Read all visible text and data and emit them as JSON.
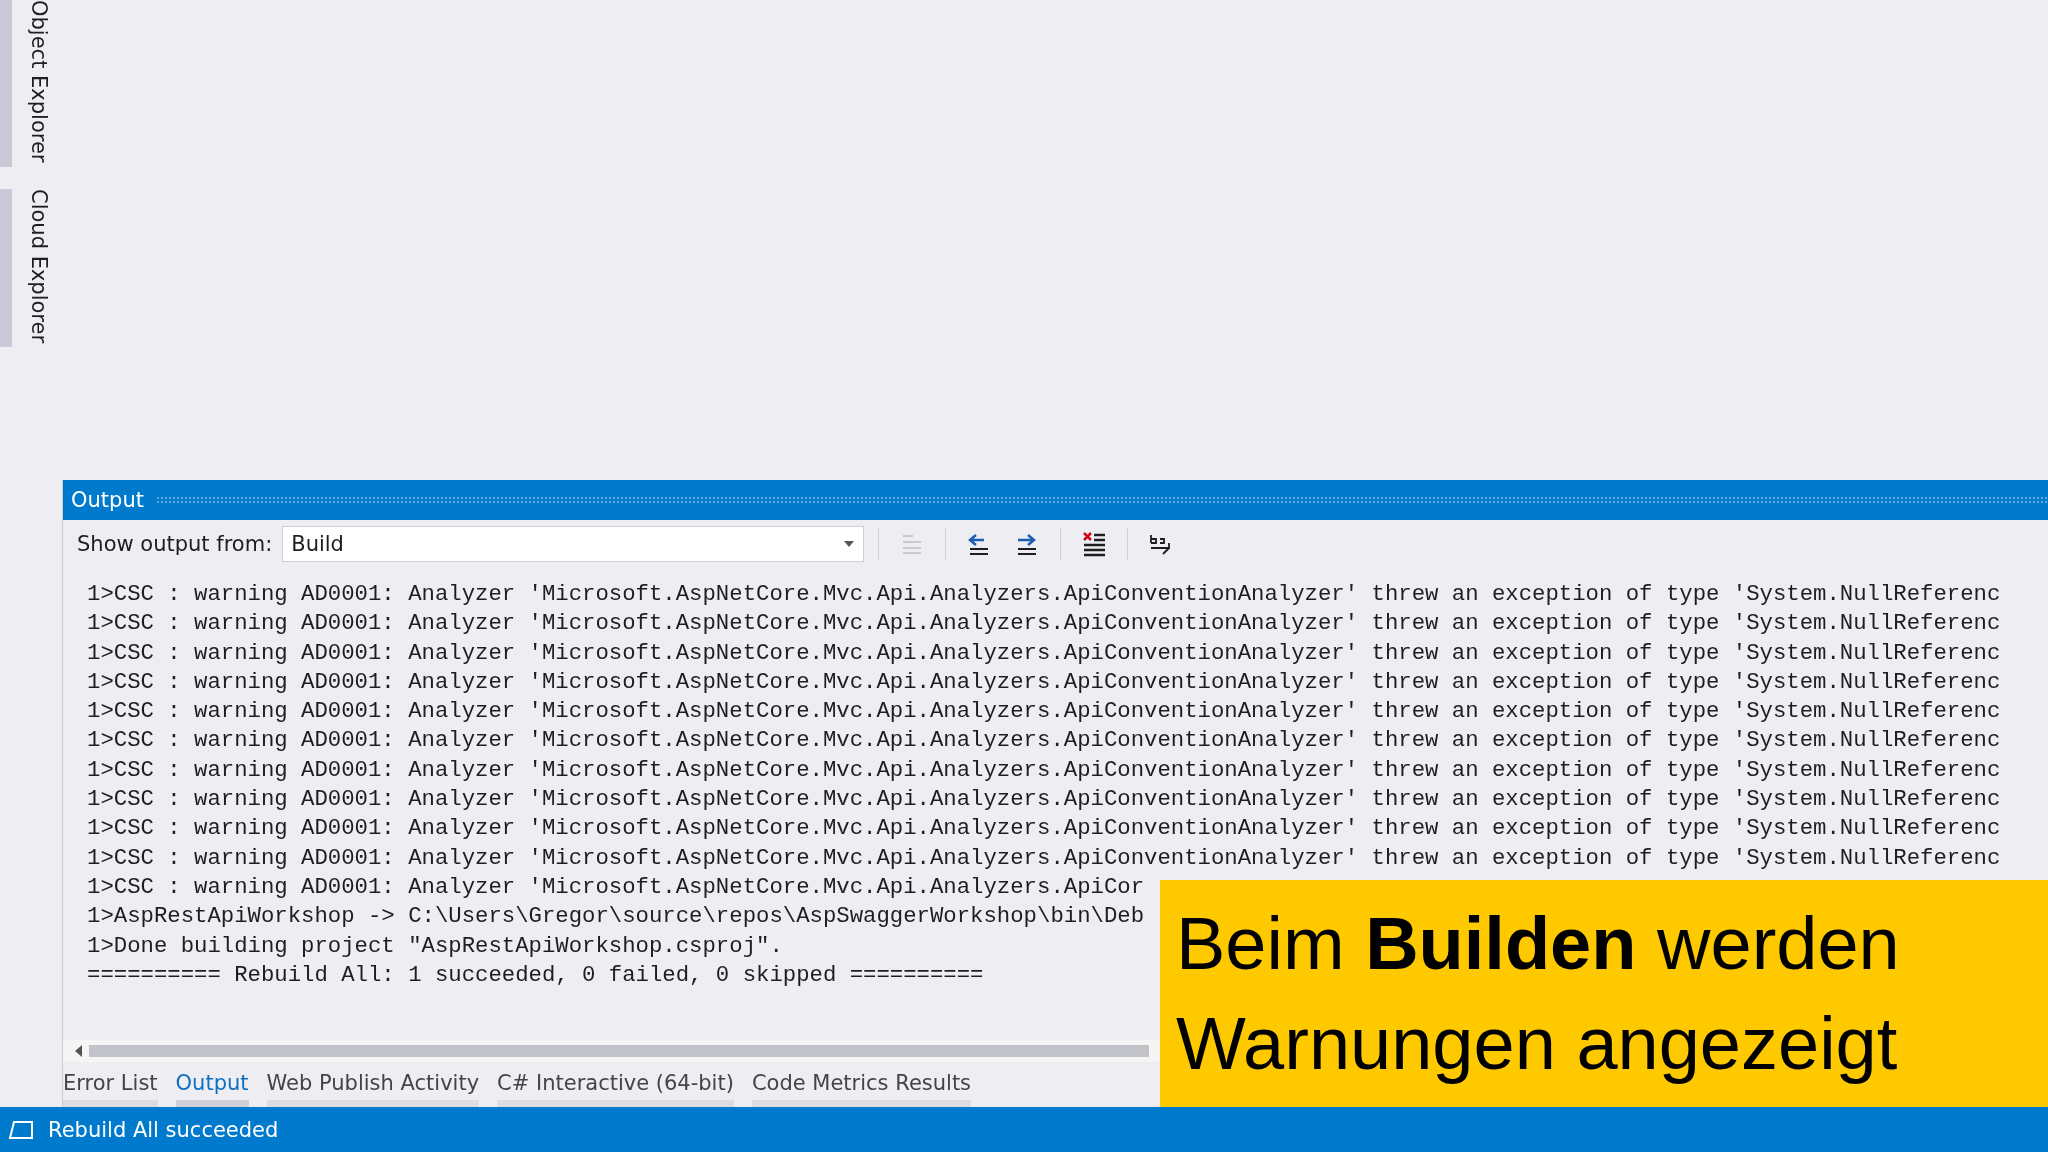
{
  "side_tabs": [
    {
      "label": "Object Explorer"
    },
    {
      "label": "Cloud Explorer"
    }
  ],
  "output_panel": {
    "title": "Output",
    "show_output_from": {
      "label": "Show output from:",
      "value": "Build"
    },
    "toolbar": [
      {
        "kind": "find-message",
        "disabled": true
      },
      {
        "kind": "previous-message",
        "disabled": false
      },
      {
        "kind": "next-message",
        "disabled": false
      },
      {
        "kind": "clear-all",
        "disabled": false
      },
      {
        "kind": "word-wrap",
        "disabled": false
      }
    ],
    "lines": [
      "1>CSC : warning AD0001: Analyzer 'Microsoft.AspNetCore.Mvc.Api.Analyzers.ApiConventionAnalyzer' threw an exception of type 'System.NullReferenc",
      "1>CSC : warning AD0001: Analyzer 'Microsoft.AspNetCore.Mvc.Api.Analyzers.ApiConventionAnalyzer' threw an exception of type 'System.NullReferenc",
      "1>CSC : warning AD0001: Analyzer 'Microsoft.AspNetCore.Mvc.Api.Analyzers.ApiConventionAnalyzer' threw an exception of type 'System.NullReferenc",
      "1>CSC : warning AD0001: Analyzer 'Microsoft.AspNetCore.Mvc.Api.Analyzers.ApiConventionAnalyzer' threw an exception of type 'System.NullReferenc",
      "1>CSC : warning AD0001: Analyzer 'Microsoft.AspNetCore.Mvc.Api.Analyzers.ApiConventionAnalyzer' threw an exception of type 'System.NullReferenc",
      "1>CSC : warning AD0001: Analyzer 'Microsoft.AspNetCore.Mvc.Api.Analyzers.ApiConventionAnalyzer' threw an exception of type 'System.NullReferenc",
      "1>CSC : warning AD0001: Analyzer 'Microsoft.AspNetCore.Mvc.Api.Analyzers.ApiConventionAnalyzer' threw an exception of type 'System.NullReferenc",
      "1>CSC : warning AD0001: Analyzer 'Microsoft.AspNetCore.Mvc.Api.Analyzers.ApiConventionAnalyzer' threw an exception of type 'System.NullReferenc",
      "1>CSC : warning AD0001: Analyzer 'Microsoft.AspNetCore.Mvc.Api.Analyzers.ApiConventionAnalyzer' threw an exception of type 'System.NullReferenc",
      "1>CSC : warning AD0001: Analyzer 'Microsoft.AspNetCore.Mvc.Api.Analyzers.ApiConventionAnalyzer' threw an exception of type 'System.NullReferenc",
      "1>CSC : warning AD0001: Analyzer 'Microsoft.AspNetCore.Mvc.Api.Analyzers.ApiCor",
      "1>AspRestApiWorkshop -> C:\\Users\\Gregor\\source\\repos\\AspSwaggerWorkshop\\bin\\Deb",
      "1>Done building project \"AspRestApiWorkshop.csproj\".",
      "========== Rebuild All: 1 succeeded, 0 failed, 0 skipped =========="
    ],
    "tabs": [
      {
        "label": "Error List",
        "selected": false
      },
      {
        "label": "Output",
        "selected": true
      },
      {
        "label": "Web Publish Activity",
        "selected": false
      },
      {
        "label": "C# Interactive (64-bit)",
        "selected": false
      },
      {
        "label": "Code Metrics Results",
        "selected": false
      }
    ]
  },
  "caption": [
    "Beim **Builden** werden",
    "Warnungen angezeigt"
  ],
  "status_bar": {
    "text": "Rebuild All succeeded"
  }
}
